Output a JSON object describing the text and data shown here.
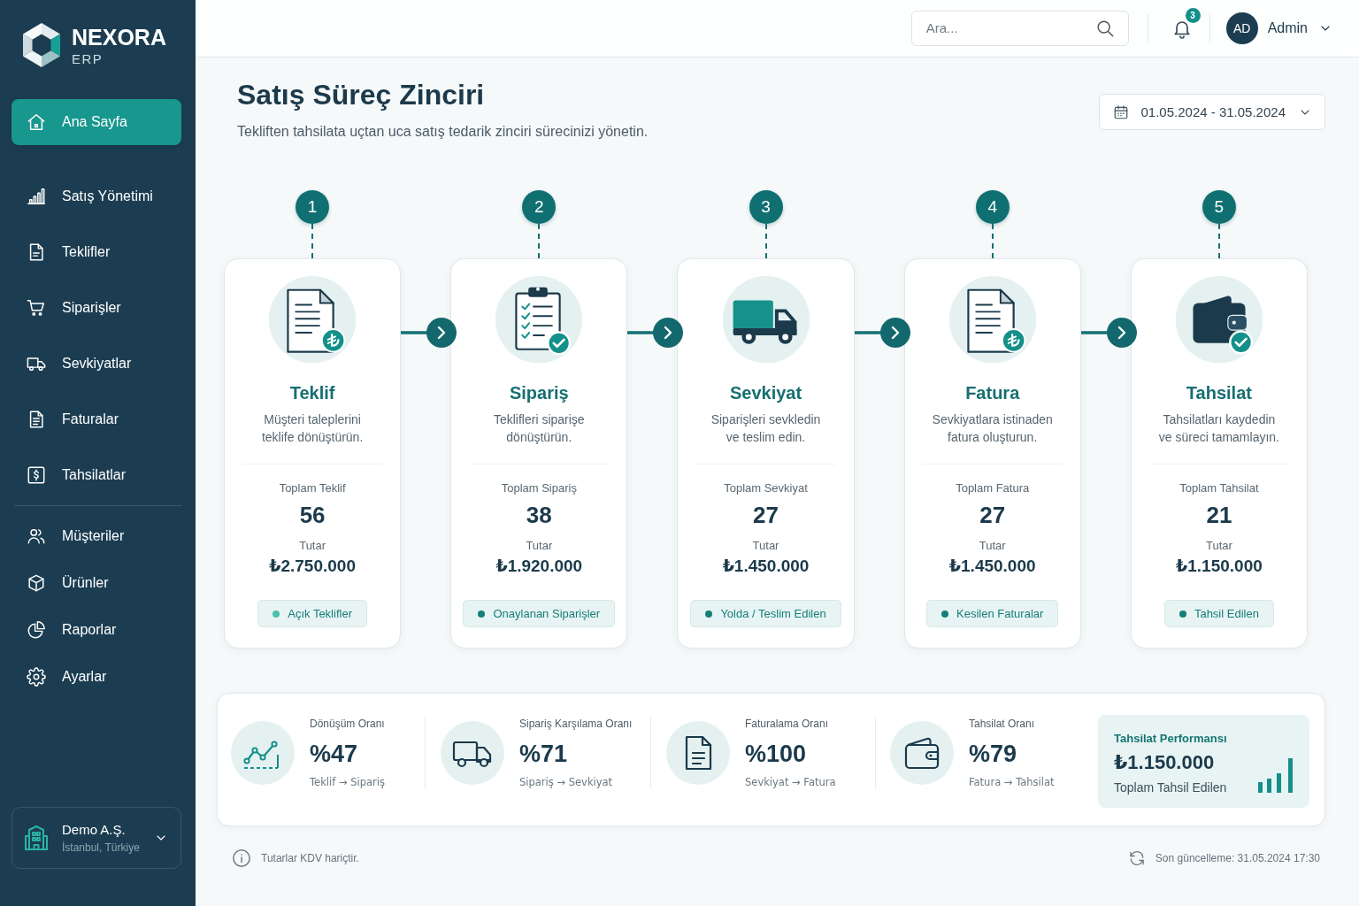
{
  "sidebar": {
    "brand": {
      "name": "NEXORA",
      "product": "ERP"
    },
    "nav_sections": [
      {
        "items": [
          {
            "label": "Ana Sayfa",
            "selected": true
          },
          {
            "label": "Satış Yönetimi",
            "selected": false
          },
          {
            "label": "Teklifler",
            "selected": false
          },
          {
            "label": "Siparişler",
            "selected": false
          },
          {
            "label": "Sevkiyatlar",
            "selected": false
          },
          {
            "label": "Faturalar",
            "selected": false
          },
          {
            "label": "Tahsilatlar",
            "selected": false
          }
        ]
      },
      {
        "items": [
          {
            "label": "Müşteriler",
            "selected": false
          },
          {
            "label": "Ürünler",
            "selected": false
          },
          {
            "label": "Raporlar",
            "selected": false
          },
          {
            "label": "Ayarlar",
            "selected": false
          }
        ]
      }
    ],
    "company": {
      "name": "Demo A.Ş.",
      "location": "İstanbul, Türkiye"
    }
  },
  "topbar": {
    "search": {
      "placeholder": "Ara..."
    },
    "notifications": {
      "count": "3"
    },
    "user": {
      "initials": "AD",
      "name": "Admin"
    }
  },
  "page": {
    "title": "Satış Süreç Zinciri",
    "subtitle": "Tekliften tahsilata uçtan uca satış tedarik zinciri sürecinizi yönetin.",
    "date_range": "01.05.2024 - 31.05.2024"
  },
  "stages": [
    {
      "step": "1",
      "title": "Teklif",
      "description": "Müşteri taleplerini\nteklife dönüştürün.",
      "count_label": "Toplam Teklif",
      "count": "56",
      "amount_label": "Tutar",
      "amount": "₺2.750.000",
      "status": {
        "label": "Açık Teklifler",
        "color": "#4cbfae"
      }
    },
    {
      "step": "2",
      "title": "Sipariş",
      "description": "Teklifleri siparişe\ndönüştürün.",
      "count_label": "Toplam Sipariş",
      "count": "38",
      "amount_label": "Tutar",
      "amount": "₺1.920.000",
      "status": {
        "label": "Onaylanan Siparişler",
        "color": "#128079"
      }
    },
    {
      "step": "3",
      "title": "Sevkiyat",
      "description": "Siparişleri sevkledin\nve teslim edin.",
      "count_label": "Toplam Sevkiyat",
      "count": "27",
      "amount_label": "Tutar",
      "amount": "₺1.450.000",
      "status": {
        "label": "Yolda / Teslim Edilen",
        "color": "#128079"
      }
    },
    {
      "step": "4",
      "title": "Fatura",
      "description": "Sevkiyatlara istinaden\nfatura oluşturun.",
      "count_label": "Toplam Fatura",
      "count": "27",
      "amount_label": "Tutar",
      "amount": "₺1.450.000",
      "status": {
        "label": "Kesilen Faturalar",
        "color": "#128079"
      }
    },
    {
      "step": "5",
      "title": "Tahsilat",
      "description": "Tahsilatları kaydedin\nve süreci tamamlayın.",
      "count_label": "Toplam Tahsilat",
      "count": "21",
      "amount_label": "Tutar",
      "amount": "₺1.150.000",
      "status": {
        "label": "Tahsil Edilen",
        "color": "#128079"
      }
    }
  ],
  "metrics": [
    {
      "label": "Dönüşüm Oranı",
      "value": "%47",
      "flow": "Teklif → Sipariş"
    },
    {
      "label": "Sipariş Karşılama Oranı",
      "value": "%71",
      "flow": "Sipariş → Sevkiyat"
    },
    {
      "label": "Faturalama Oranı",
      "value": "%100",
      "flow": "Sevkiyat → Fatura"
    },
    {
      "label": "Tahsilat Oranı",
      "value": "%79",
      "flow": "Fatura → Tahsilat"
    }
  ],
  "performance": {
    "title": "Tahsilat Performansı",
    "amount": "₺1.150.000",
    "caption": "Toplam Tahsil Edilen"
  },
  "footer": {
    "note": "Tutarlar KDV hariçtir.",
    "last_updated": "Son güncelleme: 31.05.2024 17:30"
  }
}
